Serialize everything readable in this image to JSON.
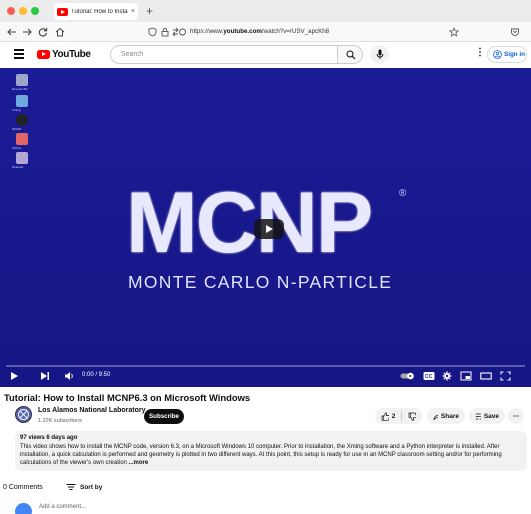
{
  "browser": {
    "tab_title": "Tutorial: How to Install MCNP6...",
    "tab_close": "×",
    "new_tab": "+",
    "url_prefix": "https://www.",
    "url_domain": "youtube.com",
    "url_suffix": "/watch?v=rUSV_apcKh8",
    "icons": {
      "back": "back-arrow-icon",
      "forward": "forward-arrow-icon",
      "reload": "reload-icon",
      "home": "home-icon",
      "shield": "shield-icon",
      "lock": "lock-icon",
      "permissions": "permissions-icon",
      "bookmark": "star-icon",
      "pocket": "pocket-icon"
    }
  },
  "yt_header": {
    "logo_text": "YouTube",
    "search_placeholder": "Search",
    "signin_label": "Sign in",
    "kebab": "⋮"
  },
  "player": {
    "logo_letters": "MCNP",
    "logo_reg": "®",
    "logo_subtitle": "MONTE CARLO N-PARTICLE",
    "time_display": "0:00 / 9:50",
    "progress_fraction": 0.0,
    "desktop_icons": [
      "Recycle Bin",
      "Xming",
      "MCNP",
      "Python",
      "Notepad"
    ]
  },
  "video": {
    "title": "Tutorial: How to Install MCNP6.3 on Microsoft Windows",
    "channel_name": "Los Alamos National Laboratory",
    "channel_subs": "1.22K subscribers",
    "subscribe_label": "Subscribe",
    "like_count": "2",
    "share_label": "Share",
    "save_label": "Save",
    "more_actions": "⋯"
  },
  "description": {
    "meta": "97 views  6 days ago",
    "text": "This video shows how to install the MCNP code, version 6.3, on a Microsoft Windows 10 computer. Prior to installation, the Xming software and a Python interpreter is installed. After installation, a quick calculation is performed and geometry is plotted in two different ways. At this point, this setup is ready for use in an MCNP classroom setting and/or for performing calculations of the viewer's own creation  ",
    "more_label": "...more"
  },
  "comments": {
    "count_label": "0 Comments",
    "sort_label": "Sort by",
    "placeholder": "Add a comment..."
  },
  "colors": {
    "youtube_red": "#ff0000",
    "player_bg": "#1b1b96",
    "link_blue": "#065fd4"
  }
}
